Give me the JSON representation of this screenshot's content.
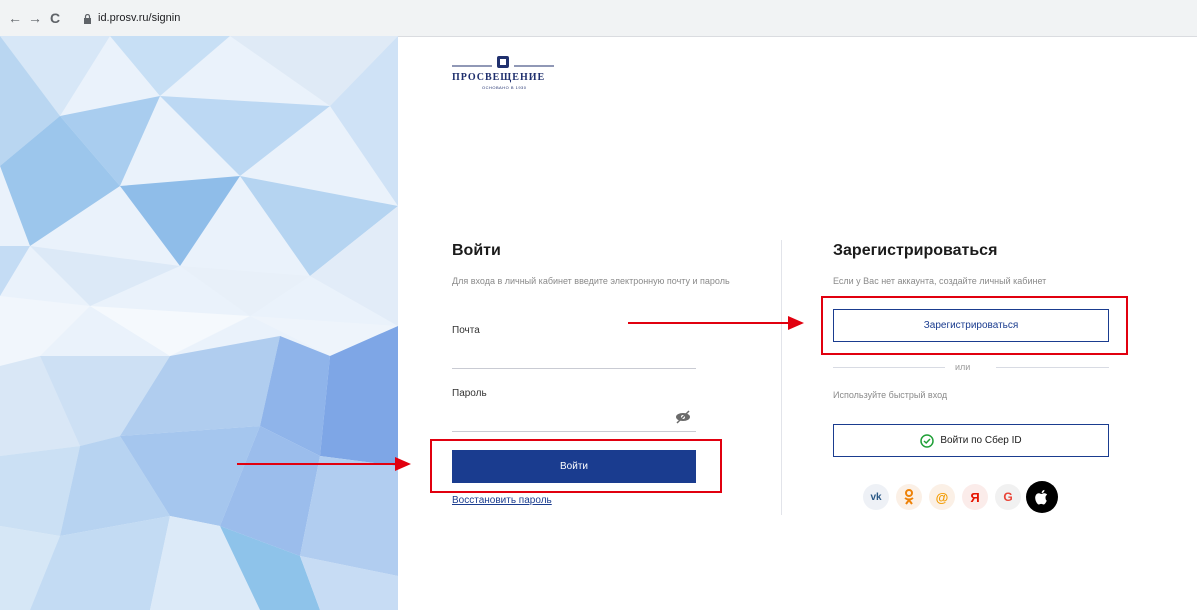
{
  "browser": {
    "url": "id.prosv.ru/signin",
    "back_glyph": "←",
    "forward_glyph": "→",
    "reload_glyph": "C"
  },
  "logo": {
    "name": "ПРОСВЕЩЕНИЕ",
    "subtitle": "ОСНОВАНО В 1930"
  },
  "login": {
    "title": "Войти",
    "hint": "Для входа в личный кабинет введите электронную почту и пароль",
    "email_label": "Почта",
    "password_label": "Пароль",
    "submit_label": "Войти",
    "restore_link": "Восстановить пароль"
  },
  "register": {
    "title": "Зарегистрироваться",
    "hint": "Если у Вас нет аккаунта, создайте личный кабинет",
    "button_label": "Зарегистрироваться",
    "or_text": "или",
    "quick_login_text": "Используйте быстрый вход",
    "sber_label": "Войти по Сбер ID"
  },
  "social": [
    {
      "id": "vk",
      "glyph": "vk",
      "color": "#2a5885",
      "bg": "#eef1f6"
    },
    {
      "id": "ok",
      "glyph": "ok",
      "color": "#ee8208",
      "bg": "#fbf0e6"
    },
    {
      "id": "mail",
      "glyph": "@",
      "color": "#f29b00",
      "bg": "#fbf0e6"
    },
    {
      "id": "yandex",
      "glyph": "Я",
      "color": "#e61400",
      "bg": "#fbecea"
    },
    {
      "id": "google",
      "glyph": "G",
      "color": "#e94235",
      "bg": "#f1f1f1"
    },
    {
      "id": "apple",
      "glyph": "",
      "color": "#ffffff",
      "bg": "#000000"
    }
  ],
  "colors": {
    "brand_blue": "#1a3c8f",
    "annotation_red": "#e1000f",
    "sber_green": "#21a038"
  }
}
